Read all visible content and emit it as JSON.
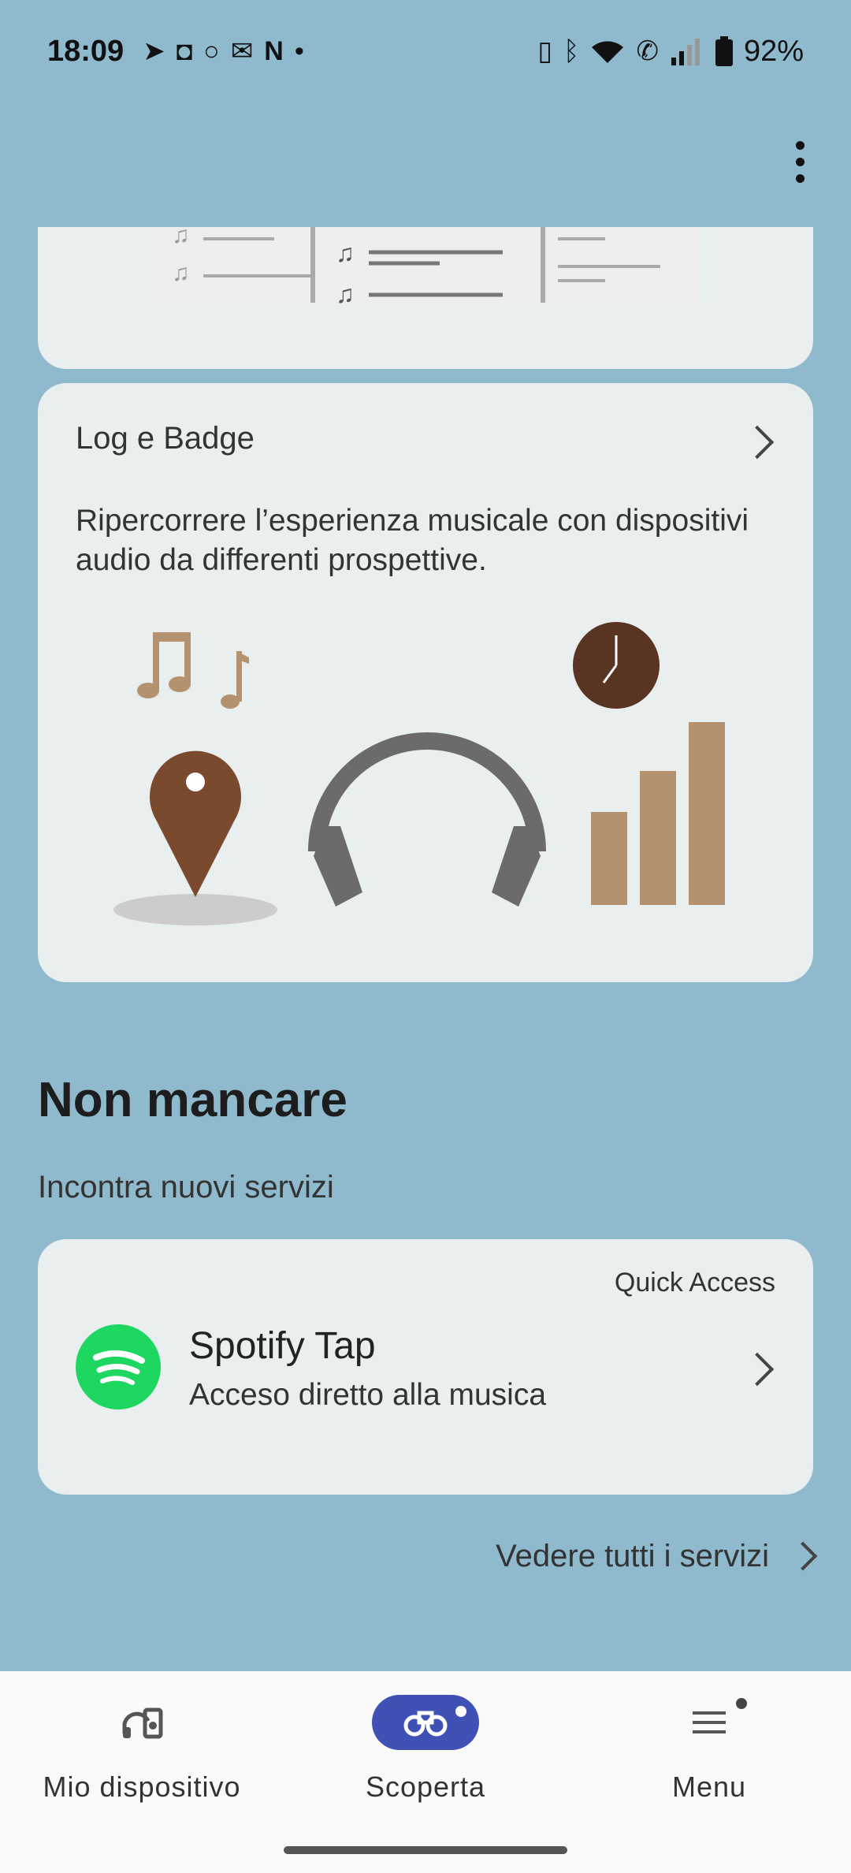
{
  "status_bar": {
    "time": "18:09",
    "notification_icons": [
      "telegram-icon",
      "instagram-icon",
      "circle-app-icon",
      "gmail-icon",
      "n-app-icon",
      "dot-icon"
    ],
    "system_icons": [
      "vibrate-icon",
      "bluetooth-icon",
      "wifi-icon",
      "wifi-call-icon",
      "signal-icon",
      "battery-icon"
    ],
    "battery": "92%"
  },
  "log_card": {
    "title": "Log e Badge",
    "description": "Ripercorrere l’esperienza musicale con dispositivi audio da differenti prospettive."
  },
  "section": {
    "title": "Non mancare",
    "subtitle": "Incontra nuovi servizi"
  },
  "service_card": {
    "tag": "Quick Access",
    "title": "Spotify Tap",
    "subtitle": "Acceso diretto alla musica"
  },
  "see_all": "Vedere tutti i servizi",
  "bottom_nav": {
    "items": [
      {
        "label": "Mio dispositivo",
        "icon": "device-icon",
        "active": false
      },
      {
        "label": "Scoperta",
        "icon": "binoculars-icon",
        "active": true
      },
      {
        "label": "Menu",
        "icon": "hamburger-icon",
        "active": false
      }
    ]
  },
  "colors": {
    "background": "#8fb9cd",
    "card": "#e9eeef",
    "accent": "#3f51b5",
    "spotify": "#1ed760",
    "pin": "#7a4a2e",
    "bars": "#b5926f",
    "clock": "#5a3422",
    "headphones": "#6b6b6b"
  }
}
